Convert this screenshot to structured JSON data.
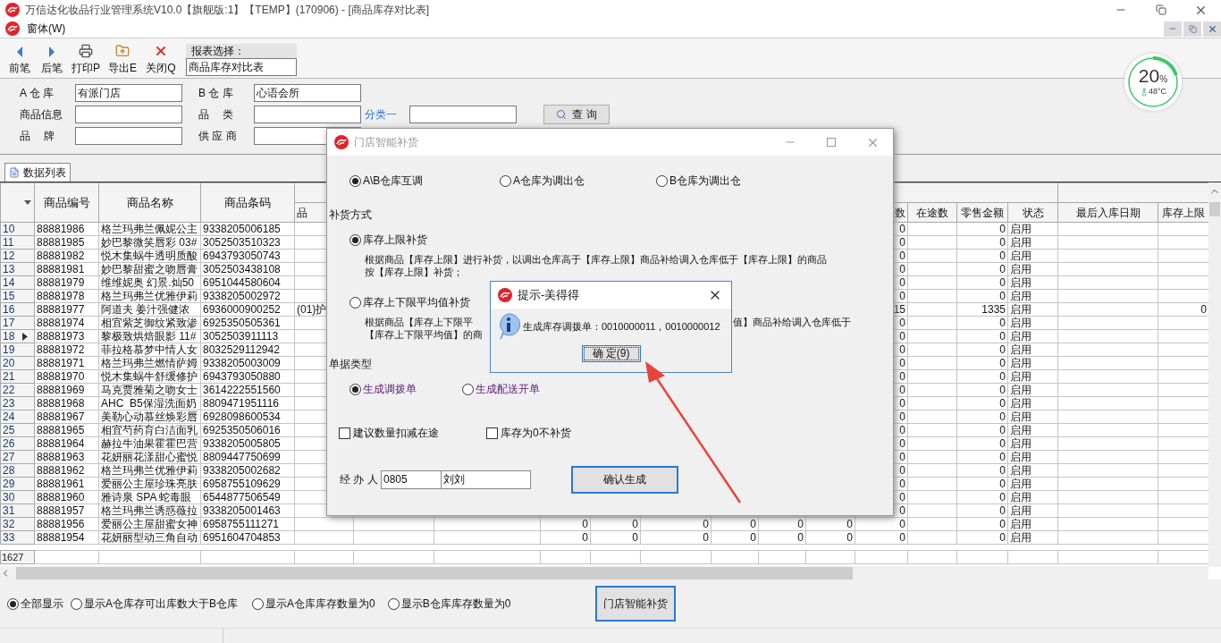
{
  "window": {
    "title": "万信达化妆品行业管理系统V10.0【旗舰版:1】【TEMP】(170906) - [商品库存对比表]"
  },
  "menu": [
    {
      "label": "窗体(W)"
    }
  ],
  "toolbar": {
    "buttons": [
      {
        "kind": "prev",
        "label": "前笔"
      },
      {
        "kind": "next",
        "label": "后笔"
      },
      {
        "kind": "print",
        "label": "打印P"
      },
      {
        "kind": "export",
        "label": "导出E"
      },
      {
        "kind": "close",
        "label": "关闭Q"
      }
    ],
    "report_label": "报表选择：",
    "report_value": "商品库存对比表"
  },
  "monitor": {
    "value": "20",
    "unit": "%",
    "temperature": "48°C",
    "level": 0.2
  },
  "filters": [
    [
      {
        "kind": "label",
        "label": "A 仓 库",
        "value": "有派门店"
      },
      {
        "kind": "label",
        "label": "B 仓 库",
        "value": "心语会所"
      }
    ],
    [
      {
        "kind": "label",
        "label": "商品信息"
      },
      {
        "kind": "label",
        "label": "品　 类"
      },
      {
        "kind": "link",
        "label": "分类一"
      }
    ],
    [
      {
        "kind": "label",
        "label": "品　 牌"
      },
      {
        "kind": "label",
        "label": "供 应 商"
      }
    ]
  ],
  "query_button": "查 询",
  "tab": {
    "label": "数据列表"
  },
  "table": {
    "columns": [
      {
        "kind": "rownum"
      },
      {
        "label": "商品编号"
      },
      {
        "label": "商品名称"
      },
      {
        "label": "商品条码"
      },
      {
        "label": "品"
      },
      {},
      {},
      {},
      {},
      {},
      {},
      {},
      {},
      {
        "label": "数"
      },
      {
        "label": "在途数"
      },
      {
        "label": "零售金额"
      },
      {
        "label": "状态"
      },
      {
        "label": "最后入库日期"
      },
      {
        "label": "库存上限"
      }
    ],
    "rows": [
      {
        "no": "10",
        "code": "88881986",
        "name": "格兰玛弗兰佩妮公主",
        "barcode": "9338205006185",
        "qty": "0",
        "amount": "0",
        "status": "启用",
        "current": false
      },
      {
        "no": "11",
        "code": "88881985",
        "name": "妙巴黎微笑唇彩 03#",
        "barcode": "3052503510323",
        "qty": "0",
        "amount": "0",
        "status": "启用",
        "current": false
      },
      {
        "no": "12",
        "code": "88881982",
        "name": "悦木集蜗牛透明质酸",
        "barcode": "6943793050743",
        "qty": "0",
        "amount": "0",
        "status": "启用",
        "current": false
      },
      {
        "no": "13",
        "code": "88881981",
        "name": "妙巴黎甜蜜之吻唇膏",
        "barcode": "3052503438108",
        "qty": "0",
        "amount": "0",
        "status": "启用",
        "current": false
      },
      {
        "no": "14",
        "code": "88881979",
        "name": "维维妮奥 幻景.灿50",
        "barcode": "6951044580604",
        "qty": "0",
        "amount": "0",
        "status": "启用",
        "current": false
      },
      {
        "no": "15",
        "code": "88881978",
        "name": "格兰玛弗兰优雅伊莉",
        "barcode": "9338205002972",
        "qty": "0",
        "amount": "0",
        "status": "启用",
        "current": false
      },
      {
        "no": "16",
        "code": "88881977",
        "name": "阿道夫 姜汁强健浓",
        "barcode": "6936000900252",
        "category": "(01)护",
        "qty": "15",
        "amount": "1335",
        "status": "启用",
        "limit": "0",
        "current": false
      },
      {
        "no": "17",
        "code": "88881974",
        "name": "相宜紫芝御纹紧致渗",
        "barcode": "6925350505361",
        "qty": "0",
        "amount": "0",
        "status": "启用",
        "current": false
      },
      {
        "no": "18",
        "code": "88881973",
        "name": "黎极致烘焙眼影 11#",
        "barcode": "3052503911113",
        "qty": "0",
        "amount": "0",
        "status": "启用",
        "current": true
      },
      {
        "no": "19",
        "code": "88881972",
        "name": "菲拉格慕梦中情人女",
        "barcode": "8032529112942",
        "qty": "0",
        "amount": "0",
        "status": "启用",
        "current": false
      },
      {
        "no": "20",
        "code": "88881971",
        "name": "格兰玛弗兰燃情萨姆",
        "barcode": "9338205003009",
        "qty": "0",
        "amount": "0",
        "status": "启用",
        "current": false
      },
      {
        "no": "21",
        "code": "88881970",
        "name": "悦木集蜗牛舒缓修护",
        "barcode": "6943793050880",
        "qty": "0",
        "amount": "0",
        "status": "启用",
        "current": false
      },
      {
        "no": "22",
        "code": "88881969",
        "name": "马克贾雅菊之吻女士",
        "barcode": "3614222551560",
        "qty": "0",
        "amount": "0",
        "status": "启用",
        "current": false
      },
      {
        "no": "23",
        "code": "88881968",
        "name": "AHC  B5保湿洗面奶",
        "barcode": "8809471951116",
        "qty": "0",
        "amount": "0",
        "status": "启用",
        "current": false
      },
      {
        "no": "24",
        "code": "88881967",
        "name": "美勒心动慕丝焕彩唇",
        "barcode": "6928098600534",
        "qty": "0",
        "amount": "0",
        "status": "启用",
        "current": false
      },
      {
        "no": "25",
        "code": "88881965",
        "name": "相宜芍药育白洁面乳",
        "barcode": "6925350506016",
        "qty": "0",
        "amount": "0",
        "status": "启用",
        "current": false
      },
      {
        "no": "26",
        "code": "88881964",
        "name": "赫拉牛油果霍霍巴营",
        "barcode": "9338205005805",
        "qty": "0",
        "amount": "0",
        "status": "启用",
        "current": false
      },
      {
        "no": "27",
        "code": "88881963",
        "name": "花妍丽花漾甜心蜜悦",
        "barcode": "8809447750699",
        "qty": "0",
        "amount": "0",
        "status": "启用",
        "current": false
      },
      {
        "no": "28",
        "code": "88881962",
        "name": "格兰玛弗兰优雅伊莉",
        "barcode": "9338205002682",
        "qty": "0",
        "amount": "0",
        "status": "启用",
        "current": false
      },
      {
        "no": "29",
        "code": "88881961",
        "name": "爱丽公主屋珍珠亮肤",
        "barcode": "6958755109629",
        "qty": "0",
        "amount": "0",
        "status": "启用",
        "current": false
      },
      {
        "no": "30",
        "code": "88881960",
        "name": "雅诗泉 SPA 蛇毒眼",
        "barcode": "6544877506549",
        "qty": "0",
        "amount": "0",
        "status": "启用",
        "current": false
      },
      {
        "no": "31",
        "code": "88881957",
        "name": "格兰玛弗兰诱惑薇拉",
        "barcode": "9338205001463",
        "qty": "0",
        "amount": "0",
        "status": "启用",
        "current": false
      },
      {
        "no": "32",
        "code": "88881956",
        "name": "爱丽公主屋甜蜜女神",
        "barcode": "6958755111271",
        "counts": [
          "0",
          "0",
          "0",
          "0",
          "0",
          "0"
        ],
        "qty": "0",
        "amount": "0",
        "status": "启用",
        "current": false
      },
      {
        "no": "33",
        "code": "88881954",
        "name": "花妍丽型动三角自动",
        "barcode": "6951604704853",
        "counts": [
          "0",
          "0",
          "0",
          "0",
          "0",
          "0"
        ],
        "qty": "0",
        "amount": "0",
        "status": "启用",
        "current": false
      }
    ],
    "total": "1627"
  },
  "filter_options": [
    {
      "label": "全部显示",
      "selected": true
    },
    {
      "label": "显示A仓库存可出库数大于B仓库",
      "selected": false
    },
    {
      "label": "显示A仓库库存数量为0",
      "selected": false
    },
    {
      "label": "显示B仓库库存数量为0",
      "selected": false
    }
  ],
  "replenish_button": "门店智能补货",
  "dialog": {
    "title": "门店智能补货",
    "directions": [
      {
        "label": "A\\B仓库互调",
        "selected": true
      },
      {
        "label": "A仓库为调出仓",
        "selected": false
      },
      {
        "label": "B仓库为调出仓",
        "selected": false
      }
    ],
    "method_label": "补货方式",
    "methods": [
      {
        "label": "库存上限补货",
        "selected": true,
        "lines": [
          [
            "根据商品【库存上限】进行补货，以调出仓库高于【库存上限】商品补给调入仓库低于【库存上限】的商品"
          ],
          [
            "按【库存上限】补货；"
          ]
        ]
      },
      {
        "label": "库存上下限平均值补货",
        "selected": false,
        "lines": [
          [
            "根据商品【库存上下限平",
            "值】商品补给调入仓库低于"
          ],
          [
            "【库存上下限平均值】的商"
          ]
        ]
      }
    ],
    "doc_label": "单据类型",
    "doc_types": [
      {
        "label": "生成调拨单",
        "selected": true
      },
      {
        "label": "生成配送开单",
        "selected": false
      }
    ],
    "options": [
      {
        "label": "建议数量扣减在途",
        "checked": false
      },
      {
        "label": "库存为0不补货",
        "checked": false
      }
    ],
    "handler": {
      "label": "经 办 人",
      "code": "0805",
      "name": "刘刘"
    },
    "confirm_button": "确认生成"
  },
  "message_box": {
    "title": "提示-美得得",
    "text": "生成库存调拨单：0010000011，0010000012",
    "button": "确 定(9)"
  }
}
